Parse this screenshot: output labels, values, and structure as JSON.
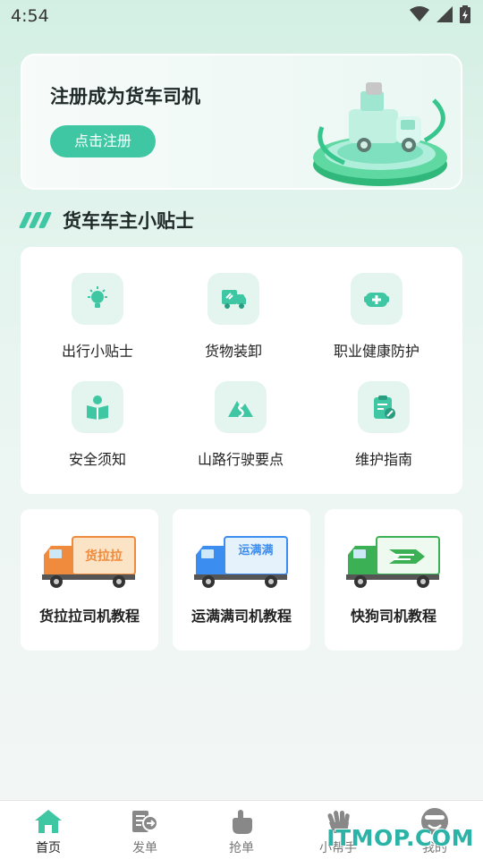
{
  "status_bar": {
    "time": "4:54"
  },
  "banner": {
    "title": "注册成为货车司机",
    "button": "点击注册"
  },
  "section": {
    "title": "货车车主小贴士"
  },
  "tips": [
    {
      "label": "出行小贴士",
      "icon": "lightbulb-icon"
    },
    {
      "label": "货物装卸",
      "icon": "truck-loading-icon"
    },
    {
      "label": "职业健康防护",
      "icon": "health-kit-icon"
    },
    {
      "label": "安全须知",
      "icon": "reading-person-icon"
    },
    {
      "label": "山路行驶要点",
      "icon": "mountain-road-icon"
    },
    {
      "label": "维护指南",
      "icon": "clipboard-wrench-icon"
    }
  ],
  "tutorials": [
    {
      "label": "货拉拉司机教程",
      "truck_text": "货拉拉",
      "color": "#f08a3c"
    },
    {
      "label": "运满满司机教程",
      "truck_text": "运满满",
      "color": "#3c8df0"
    },
    {
      "label": "快狗司机教程",
      "truck_text": "",
      "color": "#3cb054"
    }
  ],
  "tabs": [
    {
      "label": "首页",
      "icon": "home-icon",
      "active": true
    },
    {
      "label": "发单",
      "icon": "send-order-icon",
      "active": false
    },
    {
      "label": "抢单",
      "icon": "grab-order-icon",
      "active": false
    },
    {
      "label": "小帮手",
      "icon": "helper-hand-icon",
      "active": false
    },
    {
      "label": "我的",
      "icon": "profile-icon",
      "active": false
    }
  ],
  "watermark": "ITMOP.COM",
  "colors": {
    "accent": "#3fc7a3",
    "tile_bg": "#e4f5ef"
  }
}
